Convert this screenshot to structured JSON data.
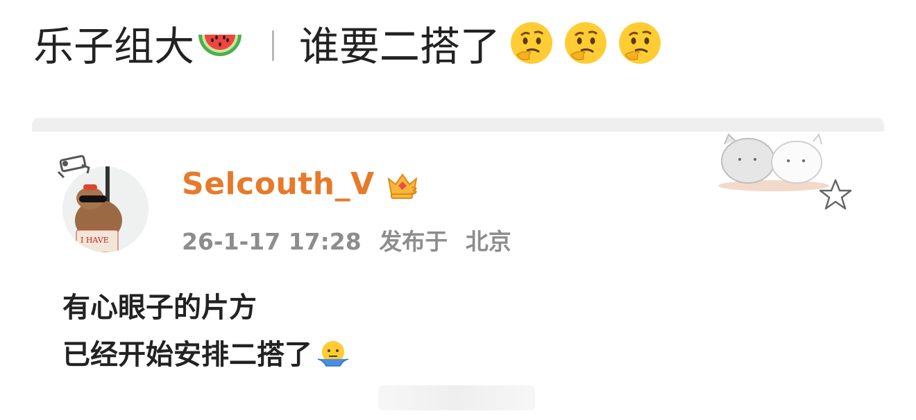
{
  "post": {
    "title_left": "乐子组大",
    "separator": "|",
    "title_right": "谁要二搭了"
  },
  "comment": {
    "username": "Selcouth_V",
    "badge_level": "3",
    "timestamp": "26-1-17 17:28",
    "location_prefix": "发布于",
    "location": "北京",
    "lines": [
      "有心眼子的片方",
      "已经开始安排二搭了"
    ]
  },
  "colors": {
    "username": "#e7792b",
    "meta": "#8d8d8d",
    "text": "#222222",
    "divider": "#efefef"
  },
  "icons": [
    "watermelon-icon",
    "thinking-face-icon",
    "camera-badge-icon",
    "crown-badge-icon",
    "shrug-icon",
    "star-icon",
    "cat-sticker-icon"
  ]
}
